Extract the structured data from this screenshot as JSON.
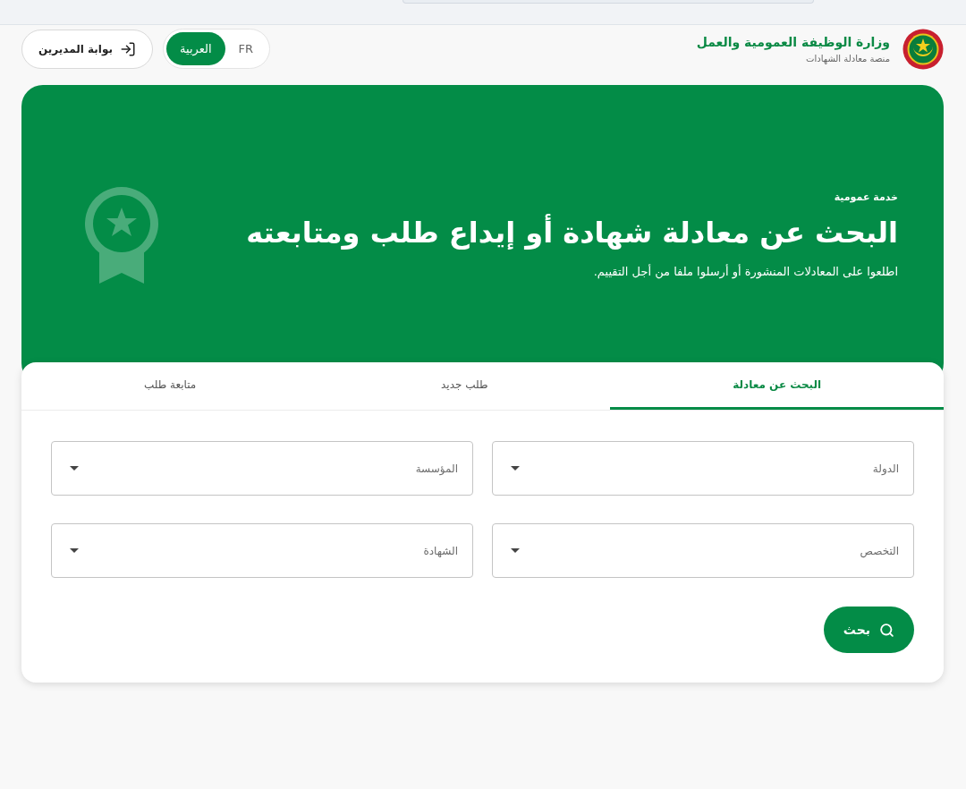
{
  "header": {
    "title": "وزارة الوظيفة العمومية والعمل",
    "subtitle": "منصة معادلة الشهادات",
    "languages": [
      {
        "label": "FR",
        "selected": false
      },
      {
        "label": "العربية",
        "selected": true
      }
    ],
    "admin_button": {
      "label": "بوابة المديرين"
    }
  },
  "hero": {
    "eyebrow": "خدمة عمومية",
    "title": "البحث عن معادلة شهادة أو إيداع طلب ومتابعته",
    "subtitle": "اطلعوا على المعادلات المنشورة أو أرسلوا ملفا من أجل التقييم."
  },
  "tabs": [
    {
      "label": "البحث عن معادلة",
      "selected": true
    },
    {
      "label": "طلب جديد",
      "selected": false
    },
    {
      "label": "متابعة طلب",
      "selected": false
    }
  ],
  "fields": [
    {
      "placeholder": "الدولة"
    },
    {
      "placeholder": "المؤسسة"
    },
    {
      "placeholder": "التخصص"
    },
    {
      "placeholder": "الشهادة"
    }
  ],
  "search_button": {
    "label": "بحث"
  }
}
